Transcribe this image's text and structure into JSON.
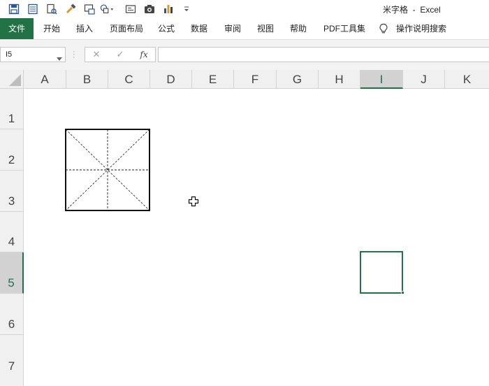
{
  "window": {
    "title": "米字格  -  Excel"
  },
  "quick_access": {
    "items": [
      "save-icon",
      "form-icon",
      "print-preview-icon",
      "format-painter-icon",
      "screenshot-icon",
      "shapes-icon",
      "textbox-icon",
      "camera-icon",
      "chart-icon",
      "customize-toolbar-icon"
    ]
  },
  "ribbon": {
    "tabs": [
      "文件",
      "开始",
      "插入",
      "页面布局",
      "公式",
      "数据",
      "审阅",
      "视图",
      "帮助",
      "PDF工具集"
    ],
    "tell_me": "操作说明搜索",
    "accent": "#217346"
  },
  "formula_bar": {
    "name_box": "I5",
    "cancel": "✕",
    "enter": "✓",
    "fx": "fx",
    "formula": ""
  },
  "grid": {
    "columns": [
      "A",
      "B",
      "C",
      "D",
      "E",
      "F",
      "G",
      "H",
      "I",
      "J",
      "K"
    ],
    "rows": [
      "1",
      "2",
      "3",
      "4",
      "5",
      "6",
      "7"
    ],
    "selected_column": "I",
    "selected_row": "5"
  }
}
